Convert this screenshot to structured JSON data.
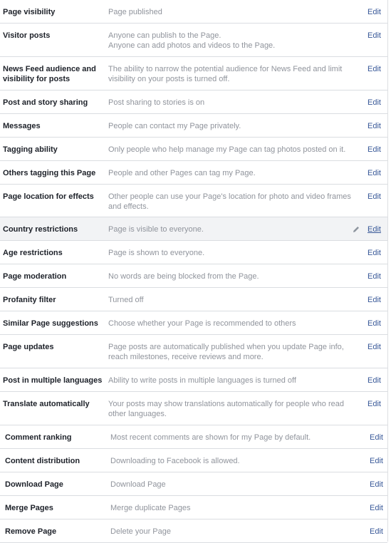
{
  "settings": {
    "rows": [
      {
        "label": "Page visibility",
        "lines": [
          "Page published"
        ],
        "action": "Edit"
      },
      {
        "label": "Visitor posts",
        "lines": [
          "Anyone can publish to the Page.",
          "Anyone can add photos and videos to the Page."
        ],
        "action": "Edit"
      },
      {
        "label": "News Feed audience and visibility for posts",
        "lines": [
          "The ability to narrow the potential audience for News Feed and limit",
          "visibility on your posts is turned off."
        ],
        "action": "Edit"
      },
      {
        "label": "Post and story sharing",
        "lines": [
          "Post sharing to stories is on"
        ],
        "action": "Edit"
      },
      {
        "label": "Messages",
        "lines": [
          "People can contact my Page privately."
        ],
        "action": "Edit"
      },
      {
        "label": "Tagging ability",
        "lines": [
          "Only people who help manage my Page can tag photos posted on it."
        ],
        "action": "Edit"
      },
      {
        "label": "Others tagging this Page",
        "lines": [
          "People and other Pages can tag my Page."
        ],
        "action": "Edit"
      },
      {
        "label": "Page location for effects",
        "lines": [
          "Other people can use your Page's location for photo and video frames",
          "and effects."
        ],
        "action": "Edit"
      },
      {
        "label": "Country restrictions",
        "lines": [
          "Page is visible to everyone."
        ],
        "action": "Edit"
      },
      {
        "label": "Age restrictions",
        "lines": [
          "Page is shown to everyone."
        ],
        "action": "Edit"
      },
      {
        "label": "Page moderation",
        "lines": [
          "No words are being blocked from the Page."
        ],
        "action": "Edit"
      },
      {
        "label": "Profanity filter",
        "lines": [
          "Turned off"
        ],
        "action": "Edit"
      },
      {
        "label": "Similar Page suggestions",
        "lines": [
          "Choose whether your Page is recommended to others"
        ],
        "action": "Edit"
      },
      {
        "label": "Page updates",
        "lines": [
          "Page posts are automatically published when you update Page info,",
          "reach milestones, receive reviews and more."
        ],
        "action": "Edit"
      },
      {
        "label": "Post in multiple languages",
        "lines": [
          "Ability to write posts in multiple languages is turned off"
        ],
        "action": "Edit"
      },
      {
        "label": "Translate automatically",
        "lines": [
          "Your posts may show translations automatically for people who read",
          "other languages."
        ],
        "action": "Edit"
      },
      {
        "label": "Comment ranking",
        "lines": [
          "Most recent comments are shown for my Page by default."
        ],
        "action": "Edit"
      },
      {
        "label": "Content distribution",
        "lines": [
          "Downloading to Facebook is allowed."
        ],
        "action": "Edit"
      },
      {
        "label": "Download Page",
        "lines": [
          "Download Page"
        ],
        "action": "Edit"
      },
      {
        "label": "Merge Pages",
        "lines": [
          "Merge duplicate Pages"
        ],
        "action": "Edit"
      },
      {
        "label": "Remove Page",
        "lines": [
          "Delete your Page"
        ],
        "action": "Edit"
      }
    ]
  },
  "colors": {
    "link": "#385898",
    "muted": "#90949c",
    "hover_row": "#f2f3f5"
  },
  "hover_row_label": "Country restrictions",
  "hover_icon": "pencil-icon"
}
